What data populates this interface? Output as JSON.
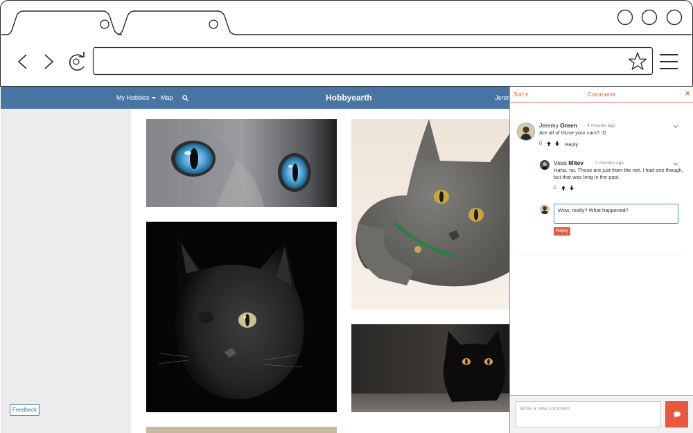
{
  "browser": {
    "address_value": ""
  },
  "site": {
    "nav": {
      "hobbies": "My Hobbies",
      "map": "Map",
      "user_name": "Jerem"
    },
    "brand": "Hobbyearth",
    "feedback_label": "Feedback"
  },
  "photos": [
    "blue-eyed-cat",
    "black-cat",
    "gray-cat",
    "black-kitten"
  ],
  "comments_panel": {
    "sort_label": "Sort",
    "title": "Comments",
    "close_glyph": "×",
    "comments": [
      {
        "first_name": "Jeremy",
        "last_name": "Green",
        "time": "4 minutes ago",
        "text": "Are all of those your cars? :D",
        "score": "0",
        "reply_label": "Reply"
      },
      {
        "first_name": "Veso",
        "last_name": "Mitev",
        "time": "2 minutes ago",
        "text": "Haha, no. Those are just from the net. I had one though, but that was long in the past.",
        "score": "0"
      }
    ],
    "reply_draft": "Wow, really? What happened?",
    "reply_submit_label": "Reply",
    "new_comment_placeholder": "Write a new comment"
  },
  "colors": {
    "header_blue": "#4a74a3",
    "accent_red": "#e05a46",
    "sidebar_gray": "#ececec"
  }
}
